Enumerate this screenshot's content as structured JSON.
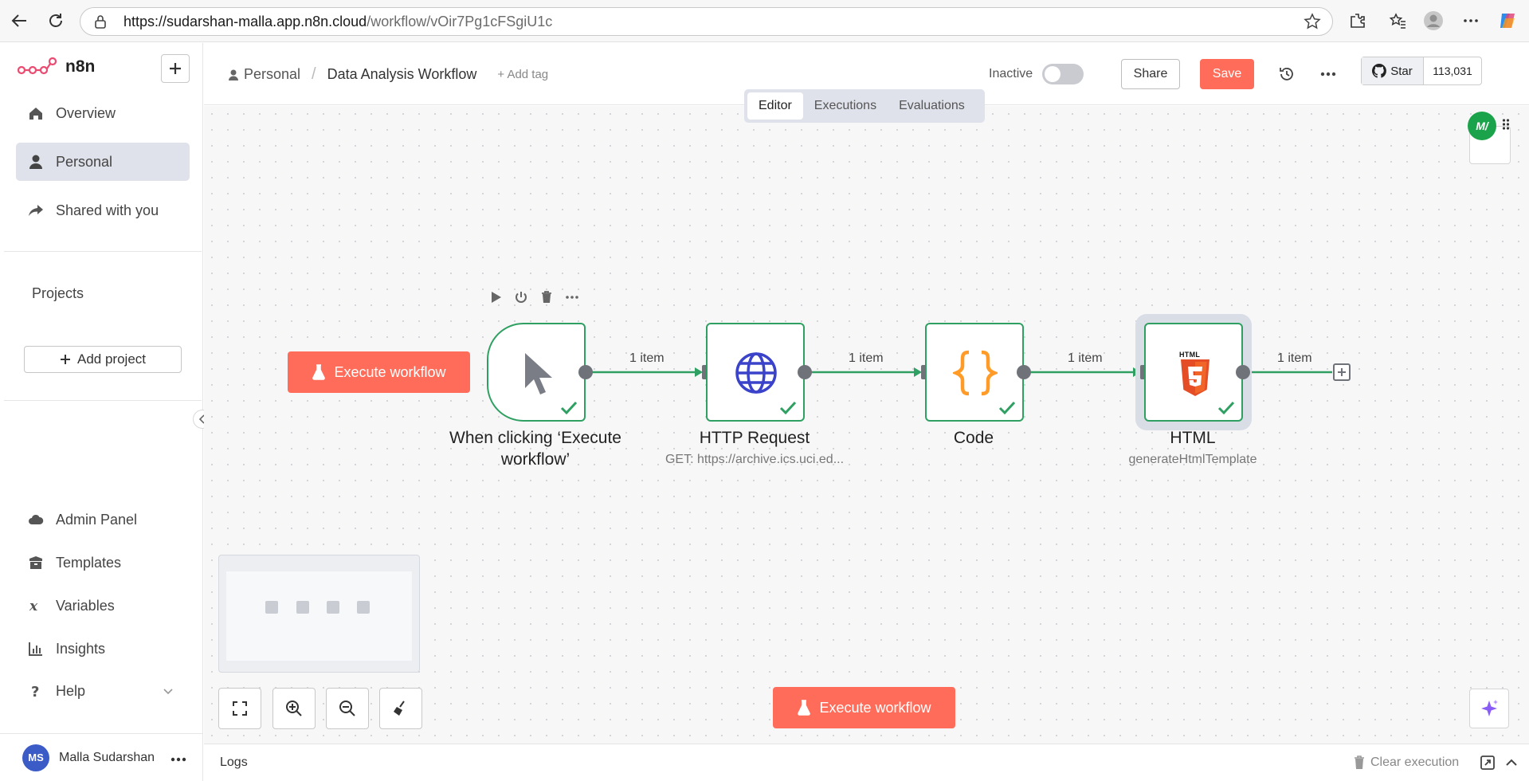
{
  "browser": {
    "url_host": "https://sudarshan-malla.app.n8n.cloud",
    "url_path": "/workflow/vOir7Pg1cFSgiU1c"
  },
  "sidebar": {
    "brand": "n8n",
    "nav": [
      {
        "label": "Overview",
        "icon": "home-icon"
      },
      {
        "label": "Personal",
        "icon": "user-icon"
      },
      {
        "label": "Shared with you",
        "icon": "share-icon"
      }
    ],
    "projects_label": "Projects",
    "add_project_label": "Add project",
    "bottom_nav": [
      {
        "label": "Admin Panel",
        "icon": "cloud-icon"
      },
      {
        "label": "Templates",
        "icon": "box-icon"
      },
      {
        "label": "Variables",
        "icon": "variable-icon"
      },
      {
        "label": "Insights",
        "icon": "chart-icon"
      },
      {
        "label": "Help",
        "icon": "help-icon"
      }
    ],
    "user": {
      "initials": "MS",
      "name": "Malla Sudarshan"
    }
  },
  "header": {
    "breadcrumb_parent": "Personal",
    "workflow_title": "Data Analysis Workflow",
    "add_tag_label": "+ Add tag",
    "status_label": "Inactive",
    "share_label": "Share",
    "save_label": "Save",
    "github_star_label": "Star",
    "github_star_count": "113,031"
  },
  "tabs": [
    {
      "label": "Editor",
      "active": true
    },
    {
      "label": "Executions",
      "active": false
    },
    {
      "label": "Evaluations",
      "active": false
    }
  ],
  "canvas": {
    "execute_label": "Execute workflow",
    "nodes": [
      {
        "name": "When clicking ‘Execute workflow’",
        "subtitle": "",
        "status": "success"
      },
      {
        "name": "HTTP Request",
        "subtitle": "GET: https://archive.ics.uci.ed...",
        "status": "success"
      },
      {
        "name": "Code",
        "subtitle": "",
        "status": "success"
      },
      {
        "name": "HTML",
        "subtitle": "generateHtmlTemplate",
        "status": "success"
      }
    ],
    "edge_labels": [
      "1 item",
      "1 item",
      "1 item",
      "1 item"
    ],
    "html_badge": "HTML"
  },
  "logs": {
    "label": "Logs",
    "clear_label": "Clear execution"
  },
  "collaborator_initials": "M",
  "colors": {
    "accent": "#ff6d5a",
    "success": "#2fa062",
    "code": "#ff9b26",
    "html5": "#e44d26",
    "globe": "#3a43c9"
  }
}
